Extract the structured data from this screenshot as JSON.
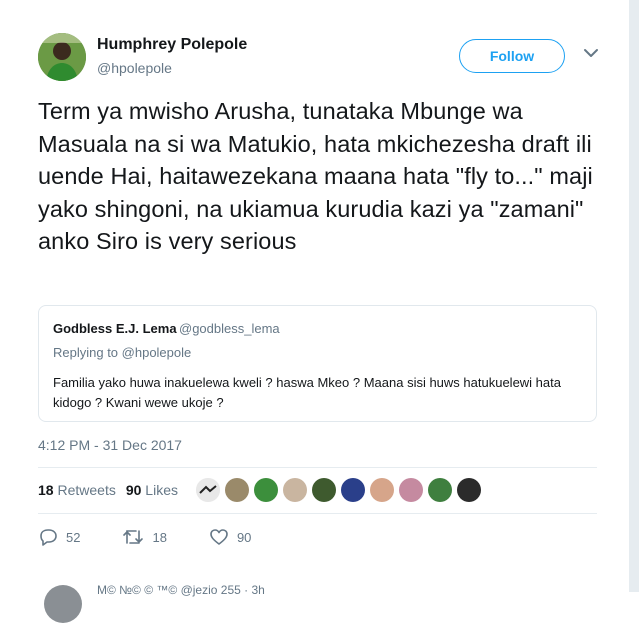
{
  "tweet": {
    "author_name": "Humphrey Polepole",
    "author_handle": "@hpolepole",
    "follow_label": "Follow",
    "text": "Term ya mwisho Arusha, tunataka Mbunge wa Masuala na si wa Matukio, hata mkichezesha draft ili uende Hai, haitawezekana maana hata \"fly to...\" maji yako shingoni, na ukiamua kurudia kazi ya \"zamani\" anko Siro is very serious",
    "timestamp": "4:12 PM - 31 Dec 2017"
  },
  "quote": {
    "author_name": "Godbless E.J. Lema",
    "author_handle": "@godbless_lema",
    "replying_prefix": "Replying to ",
    "replying_handle": "@hpolepole",
    "text": "Familia yako huwa inakuelewa kweli ? haswa Mkeo ? Maana sisi huws hatukuelewi hata kidogo ?   Kwani wewe ukoje ?"
  },
  "stats": {
    "retweets_count": "18",
    "retweets_label": "Retweets",
    "likes_count": "90",
    "likes_label": "Likes"
  },
  "actions": {
    "reply_count": "52",
    "retweet_count": "18",
    "like_count": "90"
  },
  "next_tweet": {
    "partial_text": "M© №© © ™© @jezio 255 · 3h"
  },
  "colors": {
    "accent": "#1da1f2",
    "muted": "#657786",
    "text": "#14171a",
    "border": "#e1e8ed"
  },
  "icons": [
    "chevron-down-icon",
    "reply-icon",
    "retweet-icon",
    "heart-icon"
  ]
}
